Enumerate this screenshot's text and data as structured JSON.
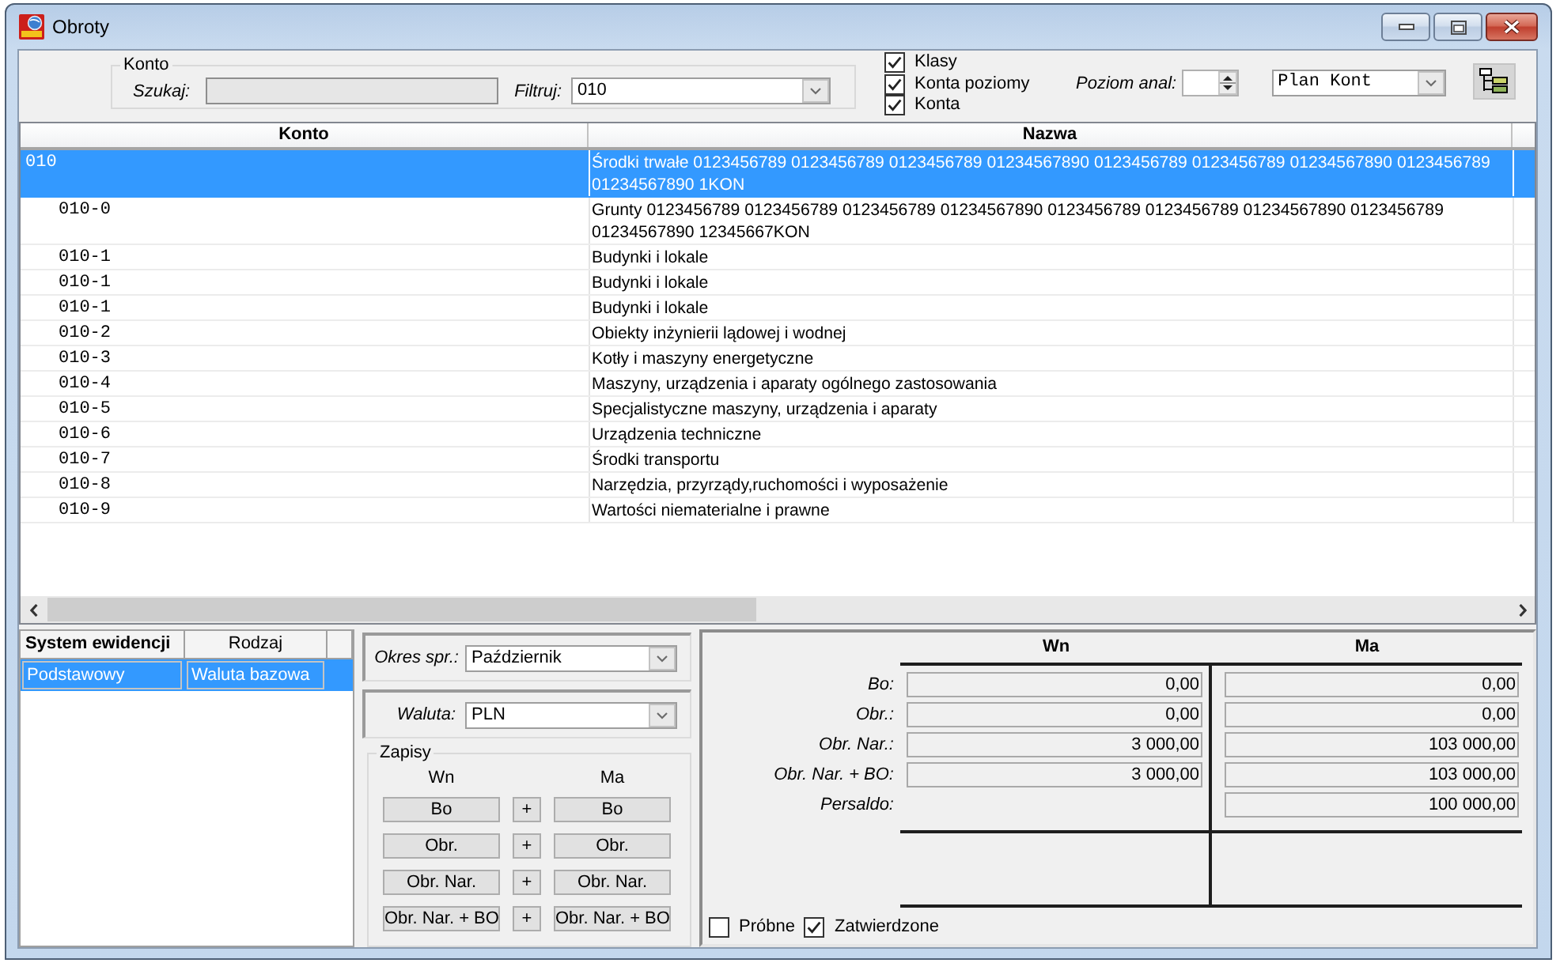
{
  "window": {
    "title": "Obroty"
  },
  "toolbar": {
    "group_label": "Konto",
    "search": {
      "label": "Szukaj:",
      "disabled": true
    },
    "filter": {
      "label": "Filtruj:",
      "value": "010"
    },
    "options": [
      {
        "label": "Klasy",
        "checked": true
      },
      {
        "label": "Konta poziomy",
        "checked": true
      },
      {
        "label": "Konta",
        "checked": true
      }
    ],
    "level": {
      "label": "Poziom anal:"
    },
    "plan": {
      "value": "Plan Kont"
    }
  },
  "table": {
    "columns": [
      "Konto",
      "Nazwa"
    ],
    "rows": [
      {
        "konto": "010",
        "nazwa": "Środki trwałe 0123456789 0123456789 0123456789 01234567890 0123456789 0123456789 01234567890 0123456789 01234567890 1KON",
        "selected": true,
        "children": [
          {
            "konto": "010-0",
            "nazwa": "Grunty 0123456789 0123456789 0123456789 01234567890 0123456789 0123456789 01234567890 0123456789 01234567890 12345667KON",
            "selected": false
          },
          {
            "konto": "010-1",
            "nazwa": "Budynki i lokale",
            "selected": false
          },
          {
            "konto": "010-1",
            "nazwa": "Budynki i lokale",
            "selected": false
          },
          {
            "konto": "010-1",
            "nazwa": "Budynki i lokale",
            "selected": false
          },
          {
            "konto": "010-2",
            "nazwa": "Obiekty inżynierii lądowej i wodnej",
            "selected": false
          },
          {
            "konto": "010-3",
            "nazwa": "Kotły i maszyny energetyczne",
            "selected": false
          },
          {
            "konto": "010-4",
            "nazwa": "Maszyny, urządzenia i aparaty ogólnego zastosowania",
            "selected": false
          },
          {
            "konto": "010-5",
            "nazwa": "Specjalistyczne maszyny, urządzenia i aparaty",
            "selected": false
          },
          {
            "konto": "010-6",
            "nazwa": "Urządzenia techniczne",
            "selected": false
          },
          {
            "konto": "010-7",
            "nazwa": "Środki transportu",
            "selected": false
          },
          {
            "konto": "010-8",
            "nazwa": "Narzędzia, przyrządy,ruchomości i wyposażenie",
            "selected": false
          },
          {
            "konto": "010-9",
            "nazwa": "Wartości niematerialne i prawne",
            "selected": false
          }
        ]
      }
    ]
  },
  "ledger_systems": {
    "columns": [
      {
        "label": "System ewidencji",
        "selected": true
      },
      {
        "label": "Rodzaj",
        "selected": false
      }
    ],
    "rows": [
      {
        "cells": [
          "Podstawowy",
          "Waluta bazowa"
        ],
        "selected": true
      }
    ]
  },
  "period": {
    "label": "Okres spr.:",
    "value": "Październik"
  },
  "currency": {
    "label": "Waluta:",
    "value": "PLN"
  },
  "entries": {
    "title": "Zapisy",
    "columns": [
      "Wn",
      "Ma"
    ],
    "rows": [
      {
        "wn": "Bo",
        "join": "+",
        "ma": "Bo"
      },
      {
        "wn": "Obr.",
        "join": "+",
        "ma": "Obr."
      },
      {
        "wn": "Obr. Nar.",
        "join": "+",
        "ma": "Obr. Nar."
      },
      {
        "wn": "Obr. Nar. + BO",
        "join": "+",
        "ma": "Obr. Nar. + BO"
      }
    ]
  },
  "totals": {
    "columns": [
      "Wn",
      "Ma"
    ],
    "rows": [
      {
        "label": "Bo:",
        "wn": "0,00",
        "ma": "0,00"
      },
      {
        "label": "Obr.:",
        "wn": "0,00",
        "ma": "0,00"
      },
      {
        "label": "Obr. Nar.:",
        "wn": "3 000,00",
        "ma": "103 000,00"
      },
      {
        "label": "Obr. Nar. + BO:",
        "wn": "3 000,00",
        "ma": "103 000,00"
      },
      {
        "label": "Persaldo:",
        "ma": "100 000,00"
      }
    ]
  },
  "status_filters": [
    {
      "label": "Próbne",
      "checked": false
    },
    {
      "label": "Zatwierdzone",
      "checked": true
    }
  ]
}
